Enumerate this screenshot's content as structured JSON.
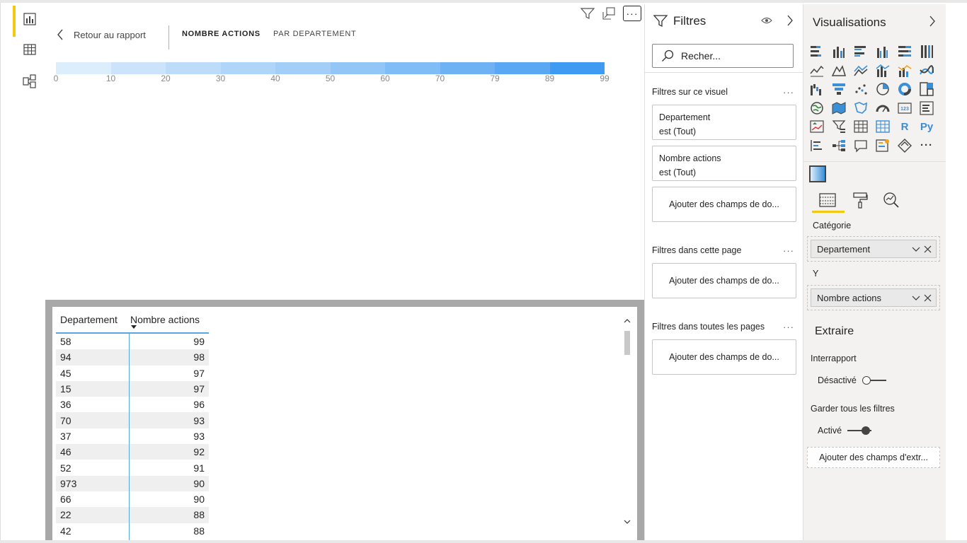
{
  "nav": {
    "items": [
      {
        "name": "report-view-icon",
        "active": true
      },
      {
        "name": "data-view-icon",
        "active": false
      },
      {
        "name": "model-view-icon",
        "active": false
      }
    ]
  },
  "canvas": {
    "back_label": "Retour au rapport",
    "tabs": [
      "NOMBRE ACTIONS",
      "PAR DEPARTEMENT"
    ],
    "legend_ticks": [
      "0",
      "10",
      "20",
      "30",
      "40",
      "50",
      "60",
      "70",
      "79",
      "89",
      "99"
    ],
    "gradient_colors": [
      "#dcedfc",
      "#cbe4fb",
      "#bcdcfa",
      "#afd5f9",
      "#a2cef8",
      "#92c6f7",
      "#80bcf6",
      "#6eb2f4",
      "#5aa8f3",
      "#3f9af1"
    ]
  },
  "table": {
    "headers": [
      "Departement",
      "Nombre actions"
    ],
    "rows": [
      [
        "58",
        "99"
      ],
      [
        "94",
        "98"
      ],
      [
        "45",
        "97"
      ],
      [
        "15",
        "97"
      ],
      [
        "36",
        "96"
      ],
      [
        "70",
        "93"
      ],
      [
        "37",
        "93"
      ],
      [
        "46",
        "92"
      ],
      [
        "52",
        "91"
      ],
      [
        "973",
        "90"
      ],
      [
        "66",
        "90"
      ],
      [
        "22",
        "88"
      ],
      [
        "42",
        "88"
      ]
    ]
  },
  "filters": {
    "title": "Filtres",
    "search_placeholder": "Recher...",
    "section_visual": "Filtres sur ce visuel",
    "cards": [
      {
        "field": "Departement",
        "condition": "est (Tout)"
      },
      {
        "field": "Nombre actions",
        "condition": "est (Tout)"
      }
    ],
    "add_label": "Ajouter des champs de do...",
    "section_page": "Filtres dans cette page",
    "section_all": "Filtres dans toutes les pages"
  },
  "visualisations": {
    "title": "Visualisations",
    "r_label": "R",
    "py_label": "Py",
    "ellipsis": "···",
    "category_label": "Catégorie",
    "category_field": "Departement",
    "y_label": "Y",
    "y_field": "Nombre actions",
    "extract_title": "Extraire",
    "cross_report_label": "Interrapport",
    "cross_report_state": "Désactivé",
    "keep_filters_label": "Garder tous les filtres",
    "keep_filters_state": "Activé",
    "add_extract": "Ajouter des champs d'extr..."
  }
}
